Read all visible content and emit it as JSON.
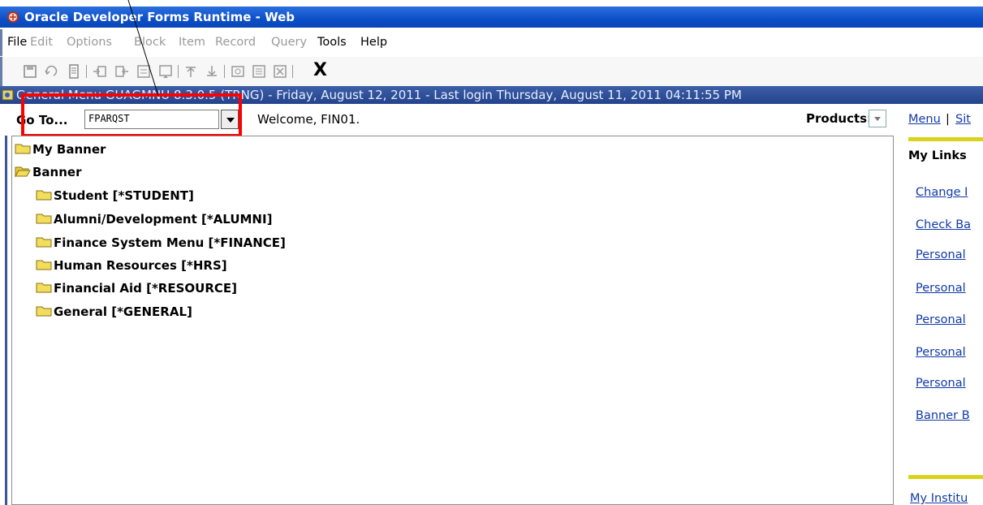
{
  "window": {
    "title": "Oracle Developer Forms Runtime - Web"
  },
  "menubar": {
    "items": [
      {
        "label": "File",
        "enabled": true
      },
      {
        "label": "Edit",
        "enabled": false
      },
      {
        "label": "Options",
        "enabled": false
      },
      {
        "label": "Block",
        "enabled": false
      },
      {
        "label": "Item",
        "enabled": false
      },
      {
        "label": "Record",
        "enabled": false
      },
      {
        "label": "Query",
        "enabled": false
      },
      {
        "label": "Tools",
        "enabled": true
      },
      {
        "label": "Help",
        "enabled": true
      }
    ]
  },
  "toolbar": {
    "exit_label": "X"
  },
  "form_header": {
    "text": "General Menu  GUAGMNU  8.3.0.5  (TRNG) - Friday, August 12, 2011 - Last login Thursday, August 11, 2011 04:11:55 PM"
  },
  "goto": {
    "label": "Go To...",
    "value": "FPARQST",
    "welcome": "Welcome, FIN01."
  },
  "products": {
    "label": "Products:"
  },
  "tree": {
    "items": [
      {
        "label": "My Banner",
        "level": 0
      },
      {
        "label": "Banner",
        "level": 0
      },
      {
        "label": "Student [*STUDENT]",
        "level": 1
      },
      {
        "label": "Alumni/Development [*ALUMNI]",
        "level": 1
      },
      {
        "label": "Finance System Menu [*FINANCE]",
        "level": 1
      },
      {
        "label": "Human Resources [*HRS]",
        "level": 1
      },
      {
        "label": "Financial Aid [*RESOURCE]",
        "level": 1
      },
      {
        "label": "General [*GENERAL]",
        "level": 1
      }
    ]
  },
  "right_panel": {
    "top_links": {
      "menu": "Menu",
      "separator": "|",
      "site": "Sit"
    },
    "heading": "My Links",
    "links": [
      "Change I",
      "Check Ba",
      "Personal",
      "Personal",
      "Personal",
      "Personal",
      "Personal",
      "Banner B"
    ],
    "institution": "My Institu"
  },
  "colors": {
    "titlebar": "#0d4fc7",
    "form_header": "#23438c",
    "highlight_box": "#ff0000",
    "link": "#123aa8",
    "yellow_bar": "#d8d41c"
  }
}
